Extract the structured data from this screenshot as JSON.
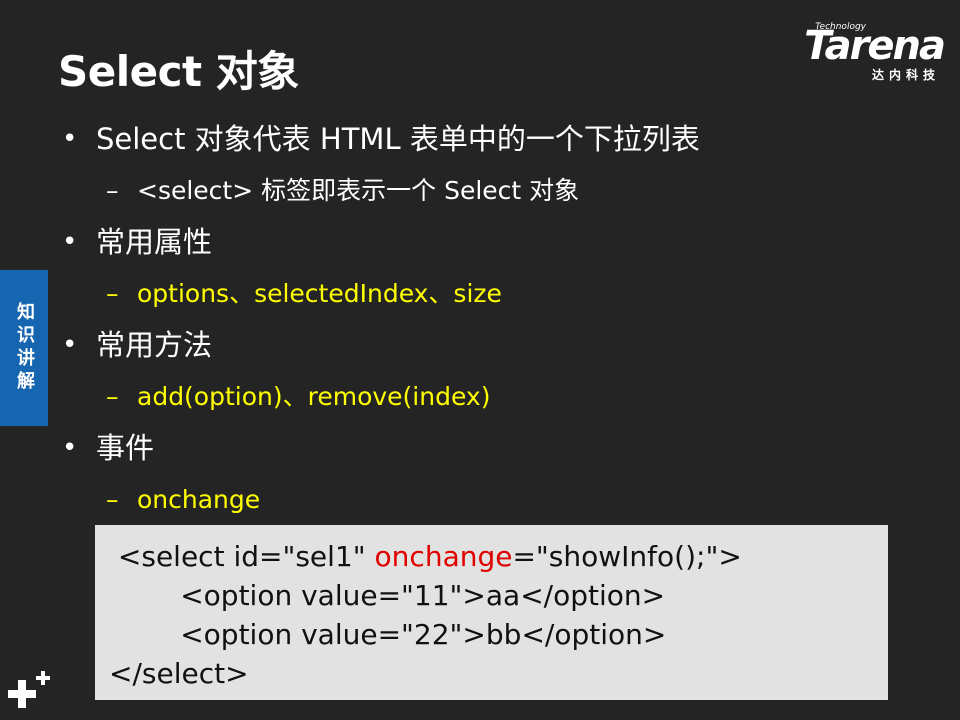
{
  "slide": {
    "title": "Select 对象"
  },
  "logo": {
    "tagline": "Technology",
    "name": "Tarena",
    "chinese": "达内科技"
  },
  "side_tab": {
    "label": "知识讲解"
  },
  "bullets": [
    {
      "text": "Select 对象代表 HTML 表单中的一个下拉列表",
      "sub": "<select> 标签即表示一个 Select 对象"
    },
    {
      "text": "常用属性",
      "sub": "options、selectedIndex、size"
    },
    {
      "text": "常用方法",
      "sub": "add(option)、remove(index)"
    },
    {
      "text": "事件",
      "sub": "onchange"
    }
  ],
  "code": {
    "line1_start": " <select id=\"sel1\" ",
    "line1_highlight": "onchange",
    "line1_end": "=\"showInfo();\">",
    "line2": "        <option value=\"11\">aa</option>",
    "line3": "        <option value=\"22\">bb</option>",
    "line4": "</select>"
  },
  "colors": {
    "background": "#242424",
    "highlight_yellow": "#ffff00",
    "code_keyword_red": "#e00000",
    "side_tab_blue": "#1565b0",
    "code_background": "#e2e2e2"
  },
  "icons": {
    "bottom_left": "plus-icon"
  }
}
